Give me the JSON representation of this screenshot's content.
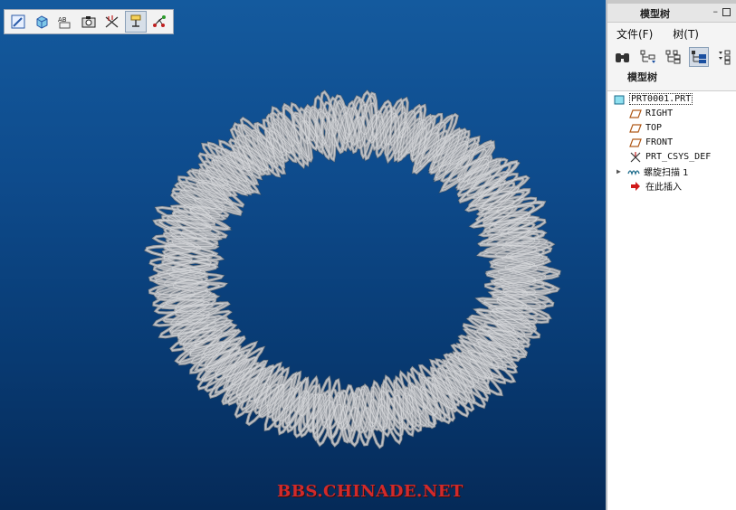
{
  "panel": {
    "title": "模型树",
    "min_glyph": "–",
    "menu": [
      {
        "label": "文件(F)"
      },
      {
        "label": "树(T)"
      }
    ],
    "section_label": "模型树"
  },
  "tree": {
    "nodes": [
      {
        "label": "PRT0001.PRT",
        "icon": "part-icon"
      },
      {
        "label": "RIGHT",
        "icon": "datum-plane-icon"
      },
      {
        "label": "TOP",
        "icon": "datum-plane-icon"
      },
      {
        "label": "FRONT",
        "icon": "datum-plane-icon"
      },
      {
        "label": "PRT_CSYS_DEF",
        "icon": "csys-icon"
      },
      {
        "label": "螺旋扫描 1",
        "icon": "helical-sweep-icon",
        "expand": "▶"
      },
      {
        "label": "在此插入",
        "icon": "insert-here-arrow-icon"
      }
    ]
  },
  "toolbar": {
    "buttons": [
      "sketch-icon",
      "shading-icon",
      "annotation-icon",
      "camera-icon",
      "datum-display-icon",
      "spin-center-icon",
      "datum-point-icon"
    ],
    "active": "spin-center-icon"
  },
  "watermark": "BBS.CHINADE.NET",
  "colors": {
    "viewport_top": "#145a9e",
    "viewport_bottom": "#052a58",
    "mesh": "#9ea2a8",
    "watermark": "#d22a2a"
  }
}
